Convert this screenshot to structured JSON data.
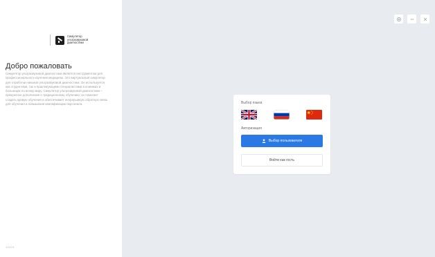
{
  "app": {
    "logo_text": "Симулятор ультразвуковой диагностики",
    "welcome_title": "Добро пожаловать",
    "welcome_text": "Симулятор ультразвуковой диагностики является инструментом для профессионального изучения медицины. Это виртуальный симулятор для отработки навыков ультразвуковой диагностики. Он используется как студентами, так и практикующими специалистами в клиниках и больницах по всему миру. Симулятор ультразвуковой диагностики – прекрасное дополнение к традиционному обучению: он помогает создать кривую обучения и обеспечивает непрерывную обратную связь для обучения и повышения квалификации персонала.",
    "version": "1.0.0.0"
  },
  "window_controls": {
    "settings_icon": "gear-icon",
    "minimize_icon": "minimize-icon",
    "close_icon": "close-icon"
  },
  "login_card": {
    "language_label": "Выбор языка",
    "languages": [
      {
        "code": "en",
        "icon": "uk-flag-icon"
      },
      {
        "code": "ru",
        "icon": "russia-flag-icon",
        "selected": true
      },
      {
        "code": "zh",
        "icon": "china-flag-icon"
      }
    ],
    "auth_label": "Авторизация",
    "select_user_label": "Выбор пользователя",
    "guest_label": "Войти как гость"
  },
  "colors": {
    "accent": "#2b79e4",
    "panel_bg": "#e8ebf0",
    "china_red": "#de2910",
    "russia_blue": "#0039a6",
    "russia_red": "#d52b1e"
  }
}
